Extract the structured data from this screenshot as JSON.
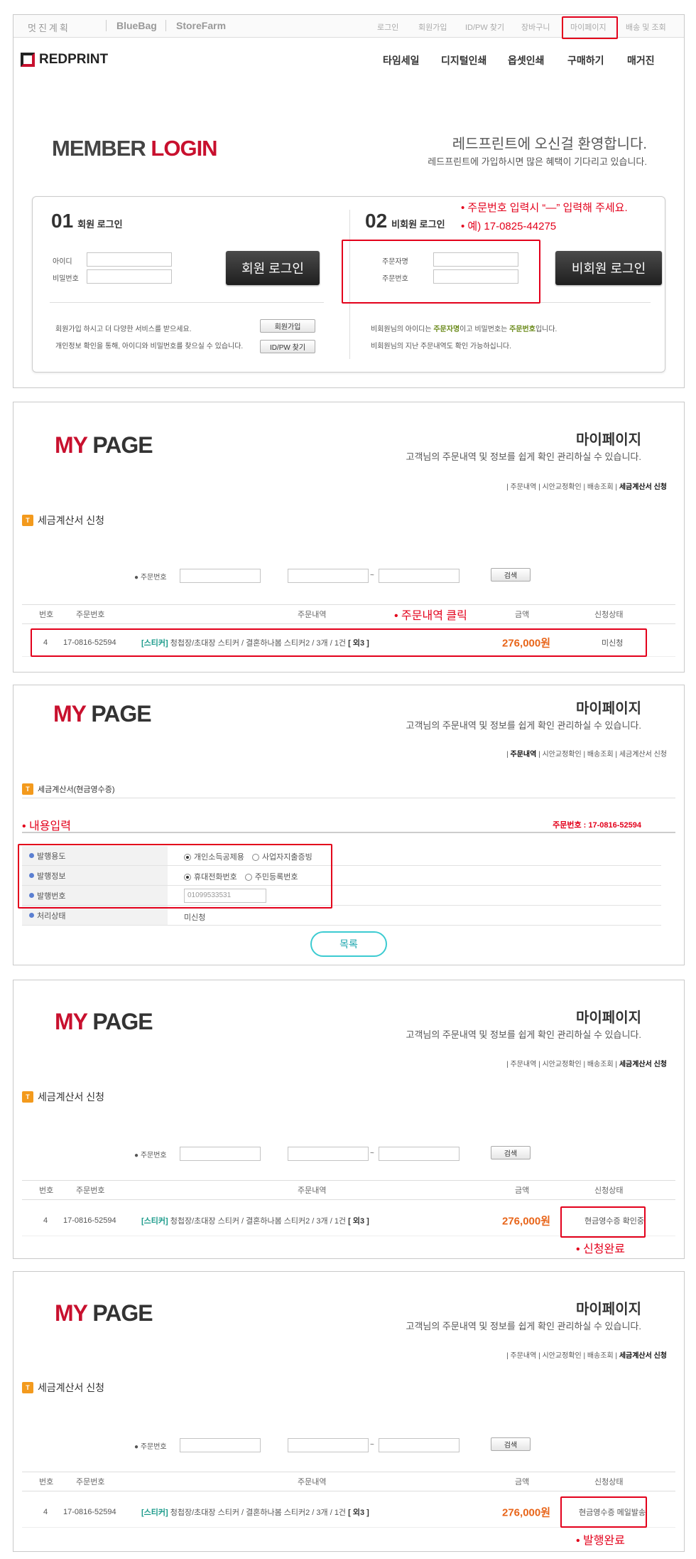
{
  "topnav": {
    "brands": [
      "멋진계획",
      "BlueBag",
      "StoreFarm"
    ],
    "links": [
      "로그인",
      "회원가입",
      "ID/PW 찾기",
      "장바구니",
      "마이페이지",
      "배송 및 조회"
    ]
  },
  "header": {
    "logo": "REDPRINT",
    "menu": [
      "타임세일",
      "디지털인쇄",
      "옵셋인쇄",
      "구매하기",
      "매거진"
    ]
  },
  "login": {
    "title_a": "MEMBER",
    "title_b": "LOGIN",
    "welcome": "레드프린트에 오신걸 환영합니다.",
    "welcome_sub": "레드프린트에 가입하시면 많은 혜택이 기다리고 있습니다.",
    "member": {
      "num": "01",
      "title": "회원 로그인",
      "id_label": "아이디",
      "pw_label": "비밀번호",
      "button": "회원 로그인",
      "info1": "회원가입 하시고 더 다양한 서비스를 받으세요.",
      "info2": "개인정보 확인을 통해, 아이디와 비밀번호를 찾으실 수 있습니다.",
      "join_btn": "회원가입",
      "find_btn": "ID/PW 찾기"
    },
    "guest": {
      "num": "02",
      "title": "비회원 로그인",
      "name_label": "주문자명",
      "order_label": "주문번호",
      "button": "비회원 로그인",
      "info1_a": "비회원님의 아이디는 ",
      "info1_b": "주문자명",
      "info1_c": "이고 비밀번호는 ",
      "info1_d": "주문번호",
      "info1_e": "입니다.",
      "info2": "비회원님의 지난 주문내역도 확인 가능하십니다."
    },
    "note1": "주문번호 입력시 “—” 입력해 주세요.",
    "note2": "예) 17-0825-44275"
  },
  "mypage": {
    "title_a": "MY",
    "title_b": "PAGE",
    "kor": "마이페이지",
    "sub": "고객님의 주문내역 및 정보를 쉽게 확인 관리하실 수 있습니다.",
    "crumbs": [
      "주문내역",
      "시안교정확인",
      "배송조회",
      "세금계산서 신청"
    ],
    "section": "세금계산서 신청",
    "section2": "세금계산서(현금영수증)",
    "search_label": "주문번호",
    "search_btn": "검색",
    "tilde": "~",
    "table_head": [
      "번호",
      "주문번호",
      "주문내역",
      "금액",
      "신청상태"
    ],
    "row": {
      "no": "4",
      "order": "17-0816-52594",
      "tag": "[스티커]",
      "desc": "청첩장/초대장 스티커 / 결혼하나봄 스티커2 / 3개 / 1건",
      "extra": "[ 외3 ]",
      "price": "276,000원"
    },
    "status1": "미신청",
    "status2": "현금영수증 확인중",
    "status3": "현금영수증 메일발송",
    "note_click": "주문내역 클릭",
    "note_input": "내용입력",
    "note_done": "신청완료",
    "note_issued": "발행완료",
    "order_no_label": "주문번호 : 17-0816-52594",
    "form": {
      "r1_label": "발행용도",
      "r1_opt1": "개인소득공제용",
      "r1_opt2": "사업자지출증빙",
      "r2_label": "발행정보",
      "r2_opt1": "휴대전화번호",
      "r2_opt2": "주민등록번호",
      "r3_label": "발행번호",
      "r3_value": "01099533531",
      "r4_label": "처리상태",
      "r4_value": "미신청"
    },
    "list_btn": "목록"
  }
}
